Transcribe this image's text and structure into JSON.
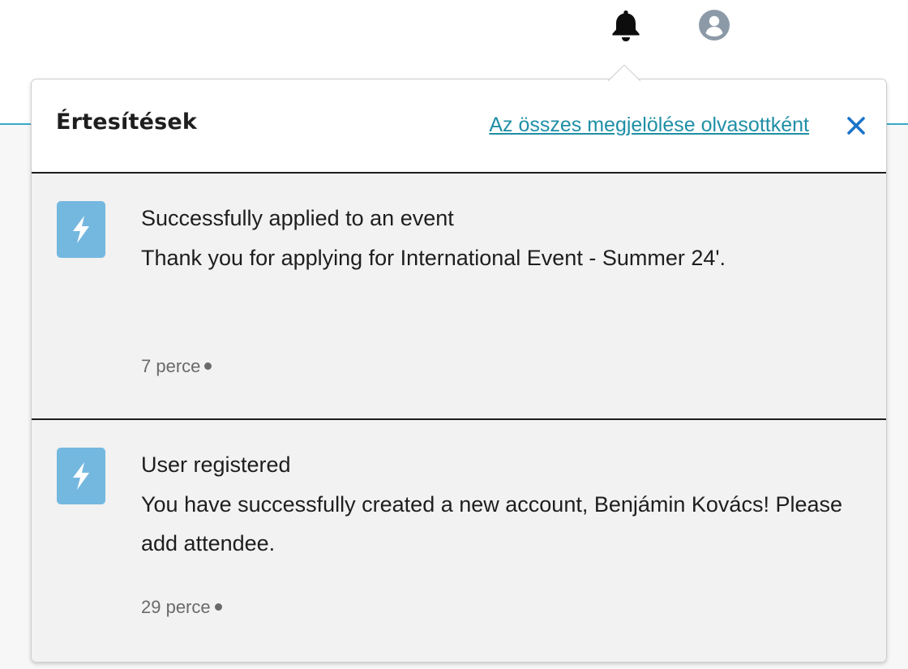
{
  "topbar": {
    "bell_icon": "bell-icon",
    "avatar_icon": "user-avatar-icon"
  },
  "notifications_panel": {
    "title": "Értesítések",
    "mark_all_read_label": "Az összes megjelölése olvasottként",
    "close_icon": "close-icon",
    "items": [
      {
        "icon": "lightning-icon",
        "title": "Successfully applied to an event",
        "body": "Thank you for applying for International Event - Summer 24'.",
        "time": "7 perce"
      },
      {
        "icon": "lightning-icon",
        "title": "User registered",
        "body": "You have successfully created a new account, Benjámin Kovács! Please add attendee.",
        "time": "29 perce"
      }
    ]
  },
  "colors": {
    "accent": "#1f8fa6",
    "icon_tile": "#74b8e0",
    "close_x": "#1a73c9",
    "avatar": "#8c9aa8"
  }
}
